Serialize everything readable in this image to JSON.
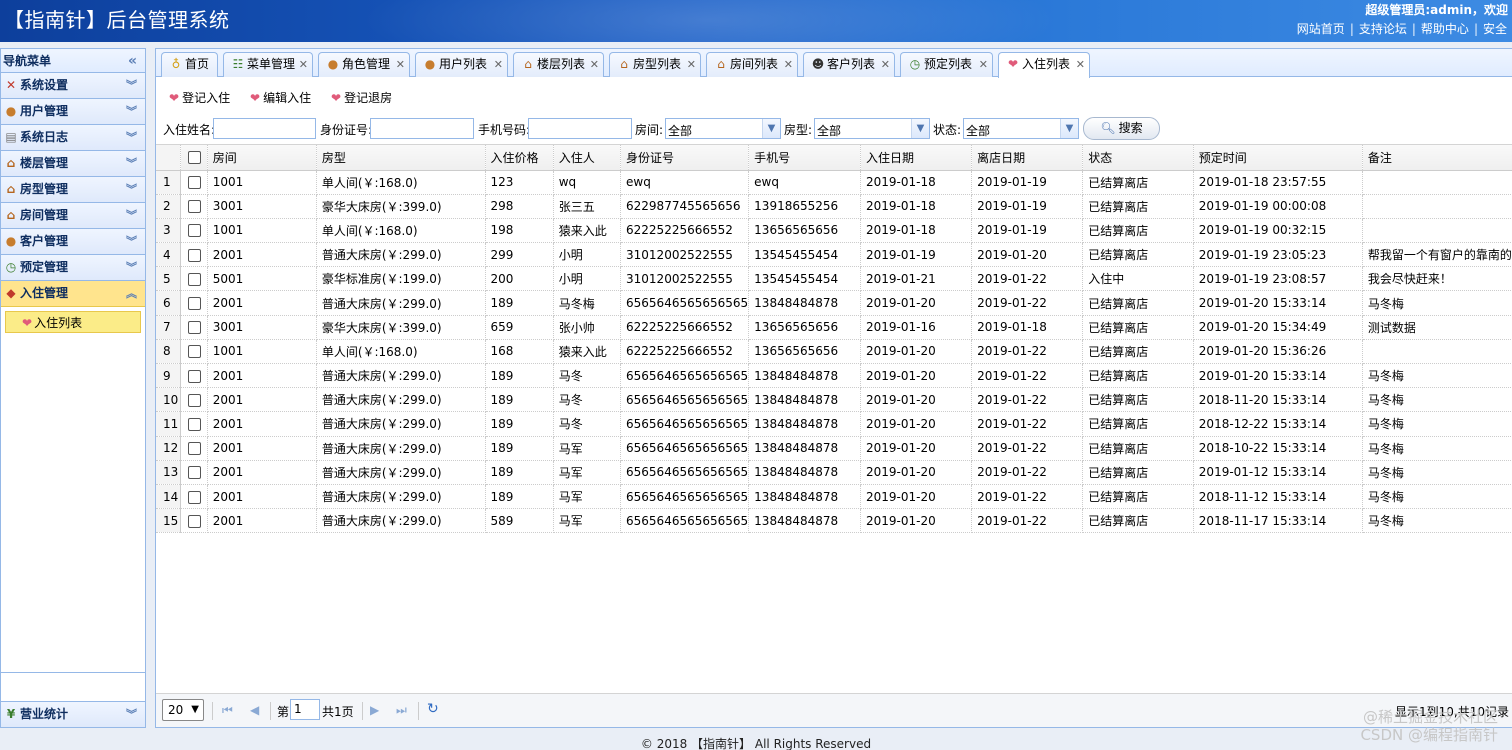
{
  "header": {
    "title": "【指南针】后台管理系统",
    "user_text": "超级管理员:admin，欢迎",
    "links": [
      "网站首页",
      "支持论坛",
      "帮助中心",
      "安全"
    ]
  },
  "sidebar": {
    "title": "导航菜单",
    "collapse_icon": "«",
    "items": [
      {
        "label": "系统设置",
        "icon": "tools-icon"
      },
      {
        "label": "用户管理",
        "icon": "users-icon"
      },
      {
        "label": "系统日志",
        "icon": "log-icon"
      },
      {
        "label": "楼层管理",
        "icon": "house-icon"
      },
      {
        "label": "房型管理",
        "icon": "house-icon"
      },
      {
        "label": "房间管理",
        "icon": "house-icon"
      },
      {
        "label": "客户管理",
        "icon": "users-icon"
      },
      {
        "label": "预定管理",
        "icon": "clock-icon"
      },
      {
        "label": "入住管理",
        "icon": "checkin-icon"
      }
    ],
    "active_sub": "入住列表",
    "bottom_item": "营业统计"
  },
  "tabs": [
    {
      "label": "首页",
      "closable": false
    },
    {
      "label": "菜单管理",
      "closable": true
    },
    {
      "label": "角色管理",
      "closable": true
    },
    {
      "label": "用户列表",
      "closable": true
    },
    {
      "label": "楼层列表",
      "closable": true
    },
    {
      "label": "房型列表",
      "closable": true
    },
    {
      "label": "房间列表",
      "closable": true
    },
    {
      "label": "客户列表",
      "closable": true
    },
    {
      "label": "预定列表",
      "closable": true
    },
    {
      "label": "入住列表",
      "closable": true,
      "active": true
    }
  ],
  "toolbar": {
    "add": "登记入住",
    "edit": "编辑入住",
    "checkout": "登记退房"
  },
  "search": {
    "name_label": "入住姓名:",
    "idcard_label": "身份证号:",
    "phone_label": "手机号码:",
    "room_label": "房间:",
    "room_value": "全部",
    "type_label": "房型:",
    "type_value": "全部",
    "status_label": "状态:",
    "status_value": "全部",
    "button": "搜索"
  },
  "table": {
    "columns": [
      "房间",
      "房型",
      "入住价格",
      "入住人",
      "身份证号",
      "手机号",
      "入住日期",
      "离店日期",
      "状态",
      "预定时间",
      "备注"
    ],
    "rows": [
      [
        "1001",
        "单人间(￥:168.0)",
        "123",
        "wq",
        "ewq",
        "ewq",
        "2019-01-18",
        "2019-01-19",
        "已结算离店",
        "2019-01-18 23:57:55",
        ""
      ],
      [
        "3001",
        "豪华大床房(￥:399.0)",
        "298",
        "张三五",
        "622987745565656",
        "13918655256",
        "2019-01-18",
        "2019-01-19",
        "已结算离店",
        "2019-01-19 00:00:08",
        ""
      ],
      [
        "1001",
        "单人间(￥:168.0)",
        "198",
        "猿来入此",
        "62225225666552",
        "13656565656",
        "2019-01-18",
        "2019-01-19",
        "已结算离店",
        "2019-01-19 00:32:15",
        ""
      ],
      [
        "2001",
        "普通大床房(￥:299.0)",
        "299",
        "小明",
        "31012002522555",
        "13545455454",
        "2019-01-19",
        "2019-01-20",
        "已结算离店",
        "2019-01-19 23:05:23",
        "帮我留一个有窗户的靠南的"
      ],
      [
        "5001",
        "豪华标准房(￥:199.0)",
        "200",
        "小明",
        "31012002522555",
        "13545455454",
        "2019-01-21",
        "2019-01-22",
        "入住中",
        "2019-01-19 23:08:57",
        "我会尽快赶来！"
      ],
      [
        "2001",
        "普通大床房(￥:299.0)",
        "189",
        "马冬梅",
        "6565646565656565",
        "13848484878",
        "2019-01-20",
        "2019-01-22",
        "已结算离店",
        "2019-01-20 15:33:14",
        "马冬梅"
      ],
      [
        "3001",
        "豪华大床房(￥:399.0)",
        "659",
        "张小帅",
        "62225225666552",
        "13656565656",
        "2019-01-16",
        "2019-01-18",
        "已结算离店",
        "2019-01-20 15:34:49",
        "测试数据"
      ],
      [
        "1001",
        "单人间(￥:168.0)",
        "168",
        "猿来入此",
        "62225225666552",
        "13656565656",
        "2019-01-20",
        "2019-01-22",
        "已结算离店",
        "2019-01-20 15:36:26",
        ""
      ],
      [
        "2001",
        "普通大床房(￥:299.0)",
        "189",
        "马冬",
        "6565646565656565",
        "13848484878",
        "2019-01-20",
        "2019-01-22",
        "已结算离店",
        "2019-01-20 15:33:14",
        "马冬梅"
      ],
      [
        "2001",
        "普通大床房(￥:299.0)",
        "189",
        "马冬",
        "6565646565656565",
        "13848484878",
        "2019-01-20",
        "2019-01-22",
        "已结算离店",
        "2018-11-20 15:33:14",
        "马冬梅"
      ],
      [
        "2001",
        "普通大床房(￥:299.0)",
        "189",
        "马冬",
        "6565646565656565",
        "13848484878",
        "2019-01-20",
        "2019-01-22",
        "已结算离店",
        "2018-12-22 15:33:14",
        "马冬梅"
      ],
      [
        "2001",
        "普通大床房(￥:299.0)",
        "189",
        "马军",
        "6565646565656565",
        "13848484878",
        "2019-01-20",
        "2019-01-22",
        "已结算离店",
        "2018-10-22 15:33:14",
        "马冬梅"
      ],
      [
        "2001",
        "普通大床房(￥:299.0)",
        "189",
        "马军",
        "6565646565656565",
        "13848484878",
        "2019-01-20",
        "2019-01-22",
        "已结算离店",
        "2019-01-12 15:33:14",
        "马冬梅"
      ],
      [
        "2001",
        "普通大床房(￥:299.0)",
        "189",
        "马军",
        "6565646565656565",
        "13848484878",
        "2019-01-20",
        "2019-01-22",
        "已结算离店",
        "2018-11-12 15:33:14",
        "马冬梅"
      ],
      [
        "2001",
        "普通大床房(￥:299.0)",
        "589",
        "马军",
        "6565646565656565",
        "13848484878",
        "2019-01-20",
        "2019-01-22",
        "已结算离店",
        "2018-11-17 15:33:14",
        "马冬梅"
      ]
    ]
  },
  "pager": {
    "page_size": "20",
    "page_prefix": "第",
    "page_value": "1",
    "page_suffix": "共1页",
    "info": "显示1到10,共10记录"
  },
  "footer": "© 2018 【指南针】 All Rights Reserved",
  "watermark": [
    "@稀土掘金技术社区",
    "CSDN @编程指南针"
  ]
}
